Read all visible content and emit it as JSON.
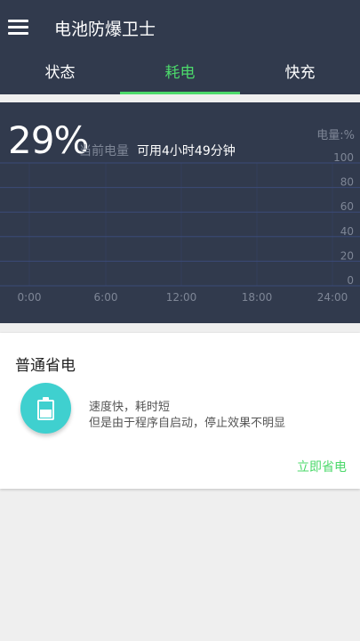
{
  "app": {
    "title": "电池防爆卫士",
    "menu_icon": "menu-icon"
  },
  "tabs": [
    {
      "label": "状态",
      "active": false
    },
    {
      "label": "耗电",
      "active": true
    },
    {
      "label": "快充",
      "active": false
    }
  ],
  "battery": {
    "percent": "29%",
    "current_label": "当前电量",
    "remaining": "可用4小时49分钟",
    "unit_label": "电量:%"
  },
  "chart_data": {
    "type": "line",
    "title": "",
    "xlabel": "",
    "ylabel": "电量:%",
    "x_ticks": [
      "0:00",
      "6:00",
      "12:00",
      "18:00",
      "24:00"
    ],
    "y_ticks": [
      "100",
      "80",
      "60",
      "40",
      "20",
      "0"
    ],
    "ylim": [
      0,
      100
    ],
    "grid": true,
    "series": []
  },
  "mode_card": {
    "title": "普通省电",
    "icon": "battery-icon",
    "desc_line1": "速度快，耗时短",
    "desc_line2": "但是由于程序自启动，停止效果不明显",
    "action_label": "立即省电"
  },
  "colors": {
    "header_bg": "#313a4d",
    "accent": "#4cd96b",
    "icon_bg": "#3fd0cf",
    "gridline": "#3b4a78",
    "tick_text": "#7e8696"
  }
}
